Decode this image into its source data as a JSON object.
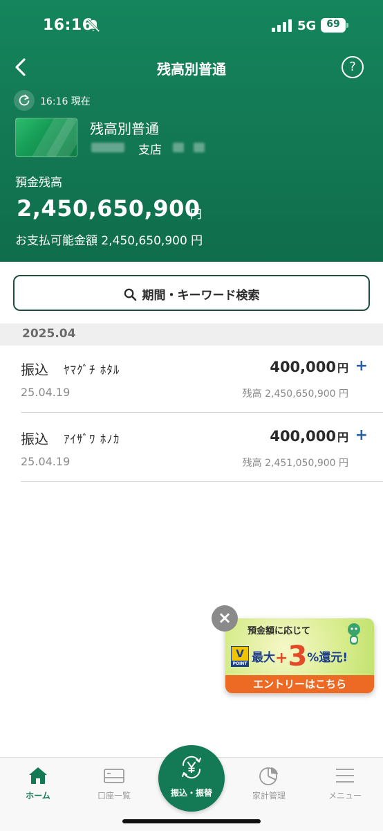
{
  "status_bar": {
    "time": "16:16",
    "network": "5G",
    "battery": "69"
  },
  "nav": {
    "title": "残高別普通"
  },
  "account": {
    "update_time": "16:16 現在",
    "name": "残高別普通",
    "branch_label": "支店",
    "balance_label": "預金残高",
    "balance": "2,450,650,900",
    "balance_unit": "円",
    "available": "お支払可能金額 2,450,650,900 円"
  },
  "search": {
    "label": "期間・キーワード検索"
  },
  "month": "2025.04",
  "transactions": [
    {
      "type": "振込",
      "name": "ﾔﾏｸﾞﾁ ﾎﾀﾙ",
      "date": "25.04.19",
      "amount": "400,000",
      "unit": "円",
      "sign": "+",
      "balance_after": "残高 2,450,650,900  円"
    },
    {
      "type": "振込",
      "name": "ｱｲｻﾞﾜ ﾎﾉｶ",
      "date": "25.04.19",
      "amount": "400,000",
      "unit": "円",
      "sign": "+",
      "balance_after": "残高 2,451,050,900  円"
    }
  ],
  "banner": {
    "close": "×",
    "top_text": "預金額に応じて",
    "logo_letter": "V",
    "logo_point": "POINT",
    "max": "最大",
    "plus": "+",
    "percent_num": "3",
    "percent_suffix": "%還元!",
    "cta": "エントリーはこちら"
  },
  "tabbar": {
    "home": "ホーム",
    "accounts": "口座一覧",
    "transfer": "振込・振替",
    "household": "家計管理",
    "menu": "メニュー"
  },
  "colors": {
    "brand_green": "#137a55",
    "accent_blue": "#2b5fa8",
    "banner_orange": "#ec6a24"
  }
}
